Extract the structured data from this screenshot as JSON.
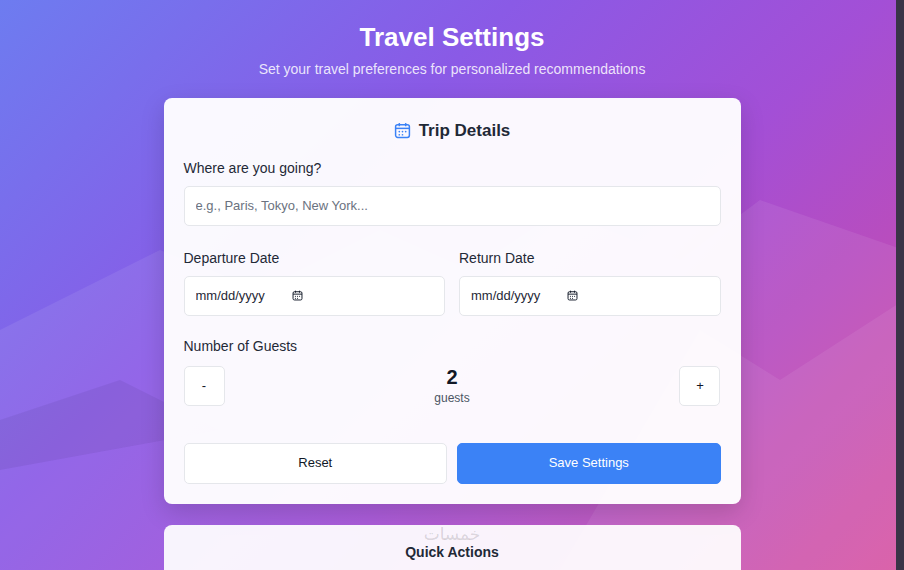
{
  "page": {
    "title": "Travel Settings",
    "subtitle": "Set your travel preferences for personalized recommendations"
  },
  "trip": {
    "title": "Trip Details",
    "destination": {
      "label": "Where are you going?",
      "placeholder": "e.g., Paris, Tokyo, New York..."
    },
    "dates": [
      {
        "label": "Departure Date",
        "placeholder": "mm/dd/yyyy"
      },
      {
        "label": "Return Date",
        "placeholder": "mm/dd/yyyy"
      }
    ],
    "guests": {
      "label": "Number of Guests",
      "decrement": "-",
      "increment": "+",
      "count": "2",
      "unit": "guests"
    },
    "buttons": [
      {
        "label": "Reset",
        "kind": "secondary"
      },
      {
        "label": "Save Settings",
        "kind": "primary"
      }
    ]
  },
  "quick_actions": {
    "title": "Quick Actions"
  },
  "watermark": "خمسات"
}
